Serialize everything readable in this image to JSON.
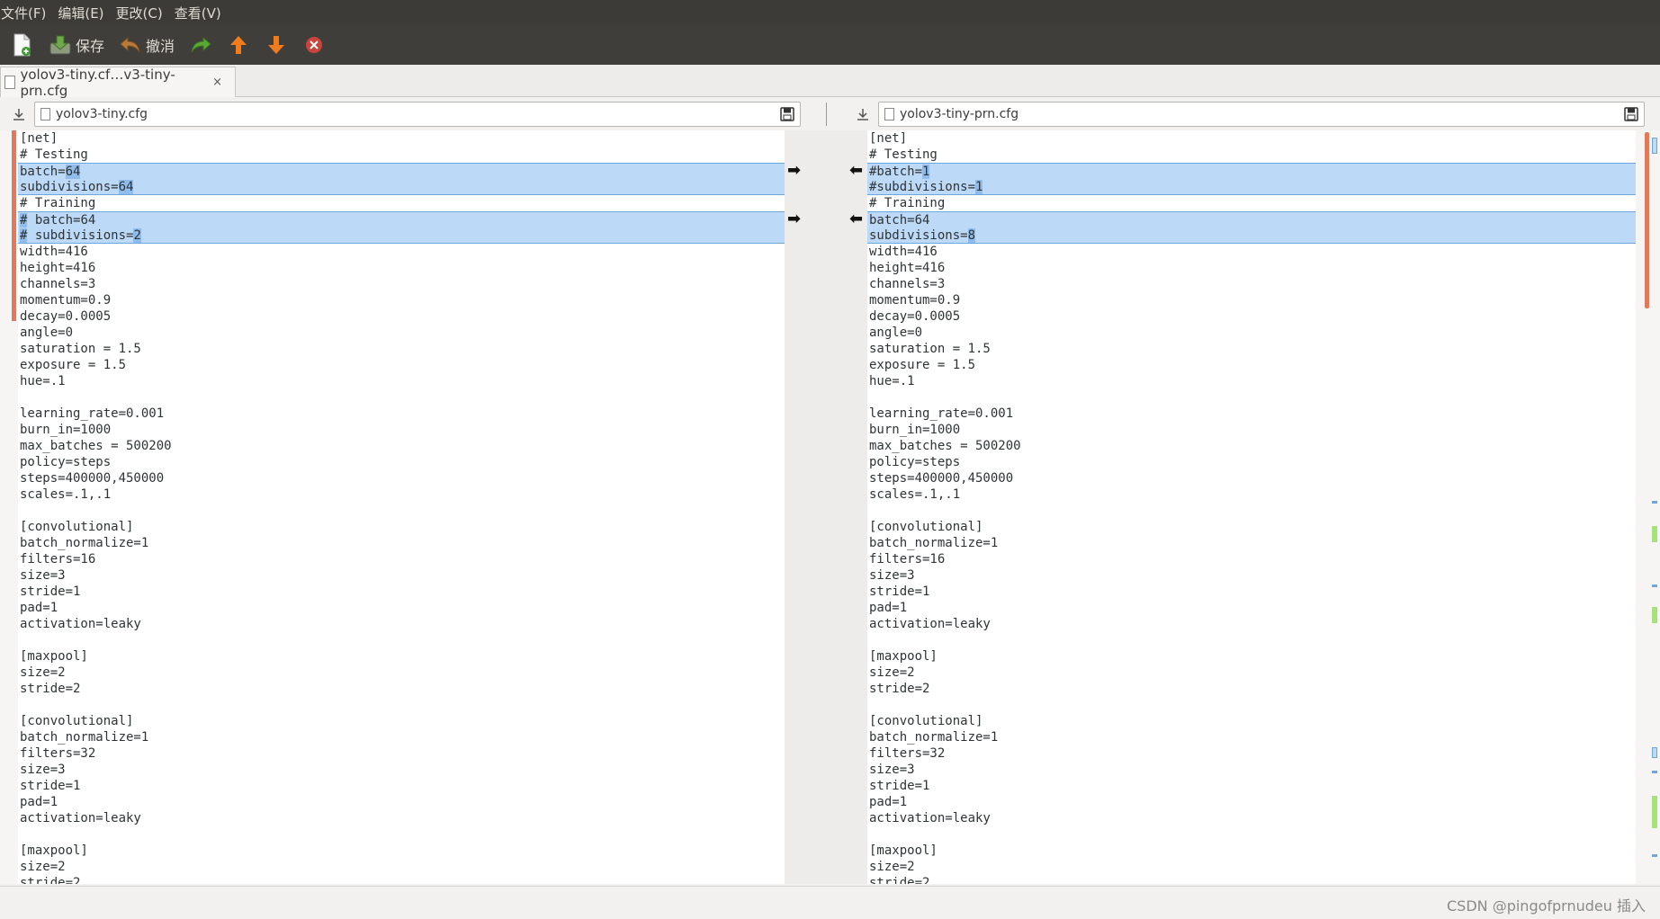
{
  "menubar": {
    "items": [
      "文件(F)",
      "编辑(E)",
      "更改(C)",
      "查看(V)"
    ]
  },
  "toolbar": {
    "new_icon": "new-document-icon",
    "save_label": "保存",
    "undo_label": "撤消",
    "icons": [
      "new-document-icon",
      "save-icon",
      "undo-icon",
      "redo-icon",
      "arrow-up-icon",
      "arrow-down-icon",
      "stop-icon"
    ],
    "colors": {
      "up_down_arrows": "#f07c1e",
      "redo": "#5aa832",
      "stop": "#d0403a"
    }
  },
  "tab": {
    "title": "yolov3-tiny.cf…v3-tiny-prn.cfg",
    "close": "×"
  },
  "left": {
    "filename": "yolov3-tiny.cfg",
    "lines": [
      "[net]",
      "# Testing",
      "batch=64",
      "subdivisions=64",
      "# Training",
      "# batch=64",
      "# subdivisions=2",
      "width=416",
      "height=416",
      "channels=3",
      "momentum=0.9",
      "decay=0.0005",
      "angle=0",
      "saturation = 1.5",
      "exposure = 1.5",
      "hue=.1",
      "",
      "learning_rate=0.001",
      "burn_in=1000",
      "max_batches = 500200",
      "policy=steps",
      "steps=400000,450000",
      "scales=.1,.1",
      "",
      "[convolutional]",
      "batch_normalize=1",
      "filters=16",
      "size=3",
      "stride=1",
      "pad=1",
      "activation=leaky",
      "",
      "[maxpool]",
      "size=2",
      "stride=2",
      "",
      "[convolutional]",
      "batch_normalize=1",
      "filters=32",
      "size=3",
      "stride=1",
      "pad=1",
      "activation=leaky",
      "",
      "[maxpool]",
      "size=2",
      "stride=2"
    ]
  },
  "right": {
    "filename": "yolov3-tiny-prn.cfg",
    "lines": [
      "[net]",
      "# Testing",
      "#batch=1",
      "#subdivisions=1",
      "# Training",
      "batch=64",
      "subdivisions=8",
      "width=416",
      "height=416",
      "channels=3",
      "momentum=0.9",
      "decay=0.0005",
      "angle=0",
      "saturation = 1.5",
      "exposure = 1.5",
      "hue=.1",
      "",
      "learning_rate=0.001",
      "burn_in=1000",
      "max_batches = 500200",
      "policy=steps",
      "steps=400000,450000",
      "scales=.1,.1",
      "",
      "[convolutional]",
      "batch_normalize=1",
      "filters=16",
      "size=3",
      "stride=1",
      "pad=1",
      "activation=leaky",
      "",
      "[maxpool]",
      "size=2",
      "stride=2",
      "",
      "[convolutional]",
      "batch_normalize=1",
      "filters=32",
      "size=3",
      "stride=1",
      "pad=1",
      "activation=leaky",
      "",
      "[maxpool]",
      "size=2",
      "stride=2"
    ]
  },
  "diff": {
    "changed_lines": [
      2,
      3,
      5,
      6
    ],
    "arrow_right": "➡",
    "arrow_left": "⬅",
    "colors": {
      "change_bg": "#bcd9f7",
      "change_highlight": "#8fbcea",
      "border": "#6ea6de",
      "conflict_marker": "#e07a5a",
      "insert_marker": "#a6e27a"
    }
  },
  "status": {
    "text": "CSDN @pingofprnudeu 插入"
  }
}
